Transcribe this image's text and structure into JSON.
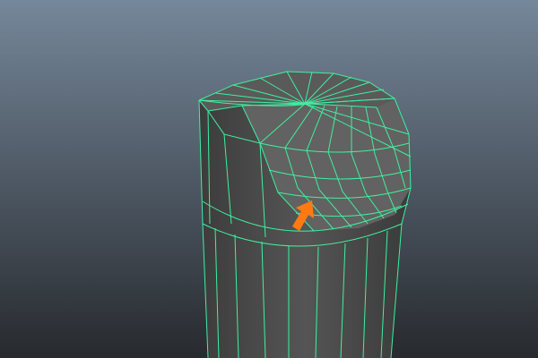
{
  "viewport": {
    "background_top": "#75879a",
    "background_bottom": "#272a2e",
    "mesh_fill": "#4b4b4b",
    "mesh_top_fill": "#5a5a5a",
    "wireframe_color": "#3ef0a0",
    "arrow_color": "#ff7a12",
    "arrow_icon": "arrow-up-right-icon"
  }
}
